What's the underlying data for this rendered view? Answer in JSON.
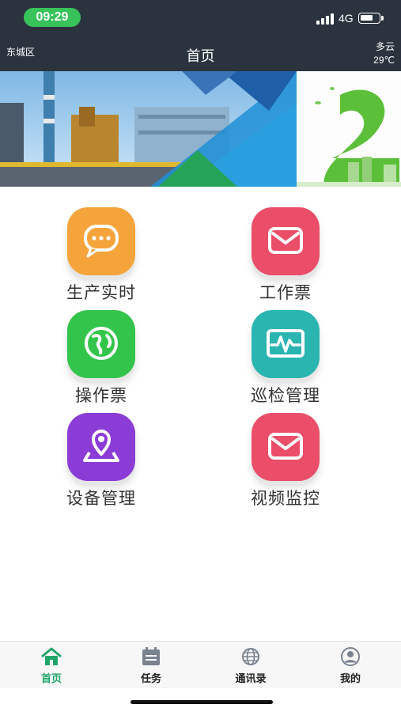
{
  "status_bar": {
    "time": "09:29",
    "network": "4G"
  },
  "header": {
    "district": "东城区",
    "title": "首页",
    "weather": "多云",
    "temperature": "29℃"
  },
  "grid": [
    {
      "label": "生产实时",
      "icon": "chat-bubble-icon",
      "color": "#f5a33b"
    },
    {
      "label": "工作票",
      "icon": "envelope-icon",
      "color": "#ea4e68"
    },
    {
      "label": "操作票",
      "icon": "globe-icon",
      "color": "#33c54b"
    },
    {
      "label": "巡检管理",
      "icon": "heartbeat-monitor-icon",
      "color": "#2ab5b0"
    },
    {
      "label": "设备管理",
      "icon": "location-pin-icon",
      "color": "#8b3bd6"
    },
    {
      "label": "视频监控",
      "icon": "envelope-icon",
      "color": "#ea4e68"
    }
  ],
  "bottom_nav": [
    {
      "label": "首页",
      "icon": "home-icon",
      "active": true
    },
    {
      "label": "任务",
      "icon": "calendar-icon",
      "active": false
    },
    {
      "label": "通讯录",
      "icon": "globe-icon",
      "active": false
    },
    {
      "label": "我的",
      "icon": "user-icon",
      "active": false
    }
  ],
  "colors": {
    "header_bg": "#2b343e",
    "accent": "#22a568",
    "time_pill": "#38c25a"
  }
}
